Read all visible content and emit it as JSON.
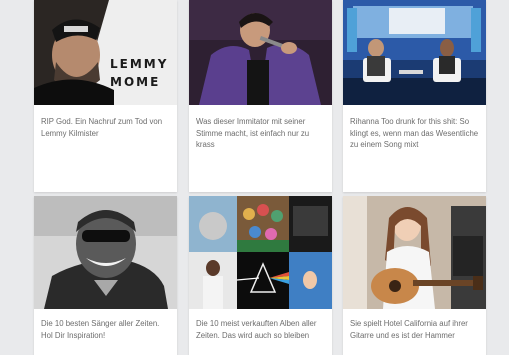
{
  "cards": [
    {
      "thumb_icon": "lemmy-kilmister-photo",
      "overlay_line1": "LEMMY",
      "overlay_line2": "MOME",
      "caption": "RIP God. Ein Nachruf zum Tod von Lemmy Kilmister"
    },
    {
      "thumb_icon": "impersonator-singing-photo",
      "caption": "Was dieser Immitator mit seiner Stimme macht, ist einfach nur zu krass"
    },
    {
      "thumb_icon": "talk-show-studio-photo",
      "caption": "Rihanna Too drunk for this shit: So klingt es, wenn man das Wesentliche zu einem Song mixt"
    },
    {
      "thumb_icon": "ray-charles-photo",
      "caption": "Die 10 besten Sänger aller Zeiten. Hol Dir Inspiration!"
    },
    {
      "thumb_icon": "album-covers-collage",
      "caption": "Die 10 meist verkauften Alben aller Zeiten. Das wird auch so bleiben"
    },
    {
      "thumb_icon": "guitarist-woman-photo",
      "caption": "Sie spielt Hotel California auf ihrer Gitarre und es ist der Hammer"
    }
  ],
  "colors": {
    "background": "#e9eaec",
    "card": "#ffffff",
    "caption_text": "#6d6d6d"
  }
}
